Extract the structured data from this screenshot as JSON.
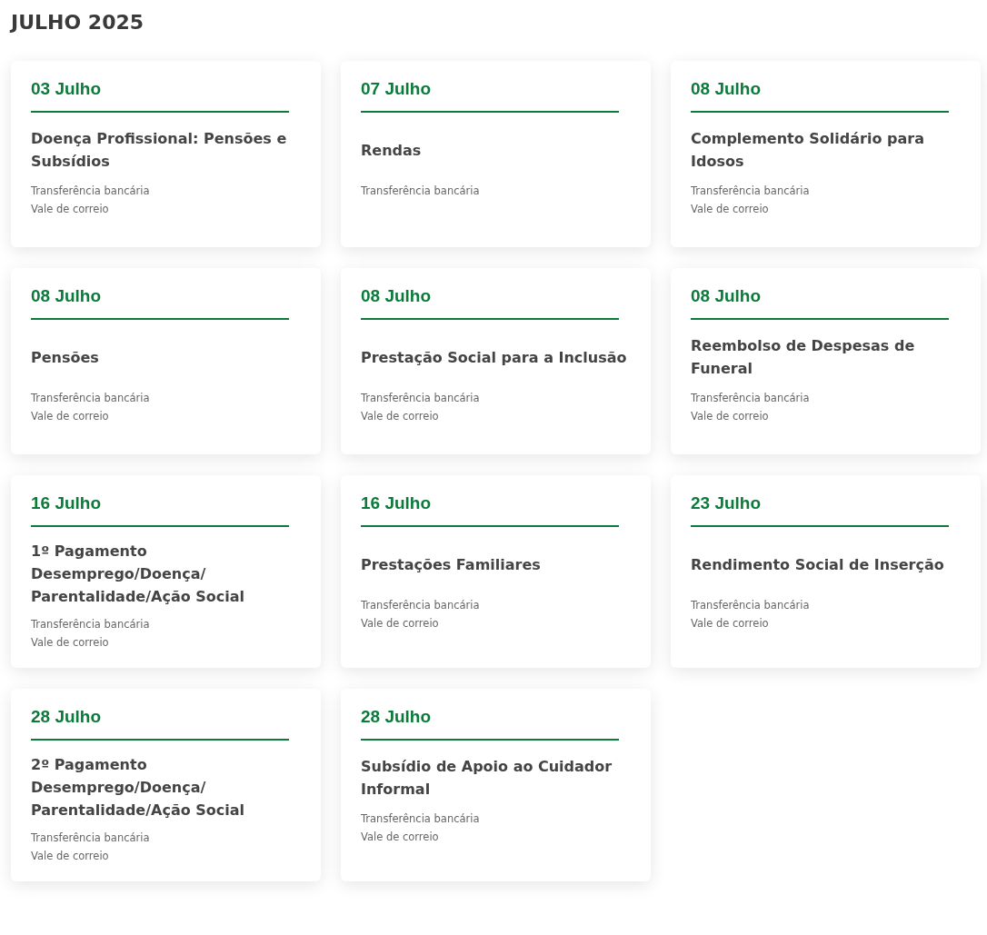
{
  "heading": "JULHO 2025",
  "cards": [
    {
      "date": "03 Julho",
      "title": "Doença Profissional: Pensões e Subsídios",
      "methods": [
        "Transferência bancária",
        "Vale de correio"
      ]
    },
    {
      "date": "07 Julho",
      "title": "Rendas",
      "methods": [
        "Transferência bancária"
      ]
    },
    {
      "date": "08 Julho",
      "title": "Complemento Solidário para Idosos",
      "methods": [
        "Transferência bancária",
        "Vale de correio"
      ]
    },
    {
      "date": "08 Julho",
      "title": "Pensões",
      "methods": [
        "Transferência bancária",
        "Vale de correio"
      ]
    },
    {
      "date": "08 Julho",
      "title": "Prestação Social para a Inclusão",
      "methods": [
        "Transferência bancária",
        "Vale de correio"
      ]
    },
    {
      "date": "08 Julho",
      "title": "Reembolso de Despesas de Funeral",
      "methods": [
        "Transferência bancária",
        "Vale de correio"
      ]
    },
    {
      "date": "16 Julho",
      "title": "1º Pagamento Desemprego/Doença/ Parentalidade/Ação Social",
      "methods": [
        "Transferência bancária",
        "Vale de correio"
      ]
    },
    {
      "date": "16 Julho",
      "title": "Prestações Familiares",
      "methods": [
        "Transferência bancária",
        "Vale de correio"
      ]
    },
    {
      "date": "23 Julho",
      "title": "Rendimento Social de Inserção",
      "methods": [
        "Transferência bancária",
        "Vale de correio"
      ]
    },
    {
      "date": "28 Julho",
      "title": "2º Pagamento Desemprego/Doença/ Parentalidade/Ação Social",
      "methods": [
        "Transferência bancária",
        "Vale de correio"
      ]
    },
    {
      "date": "28 Julho",
      "title": "Subsídio de Apoio ao Cuidador Informal",
      "methods": [
        "Transferência bancária",
        "Vale de correio"
      ]
    }
  ]
}
